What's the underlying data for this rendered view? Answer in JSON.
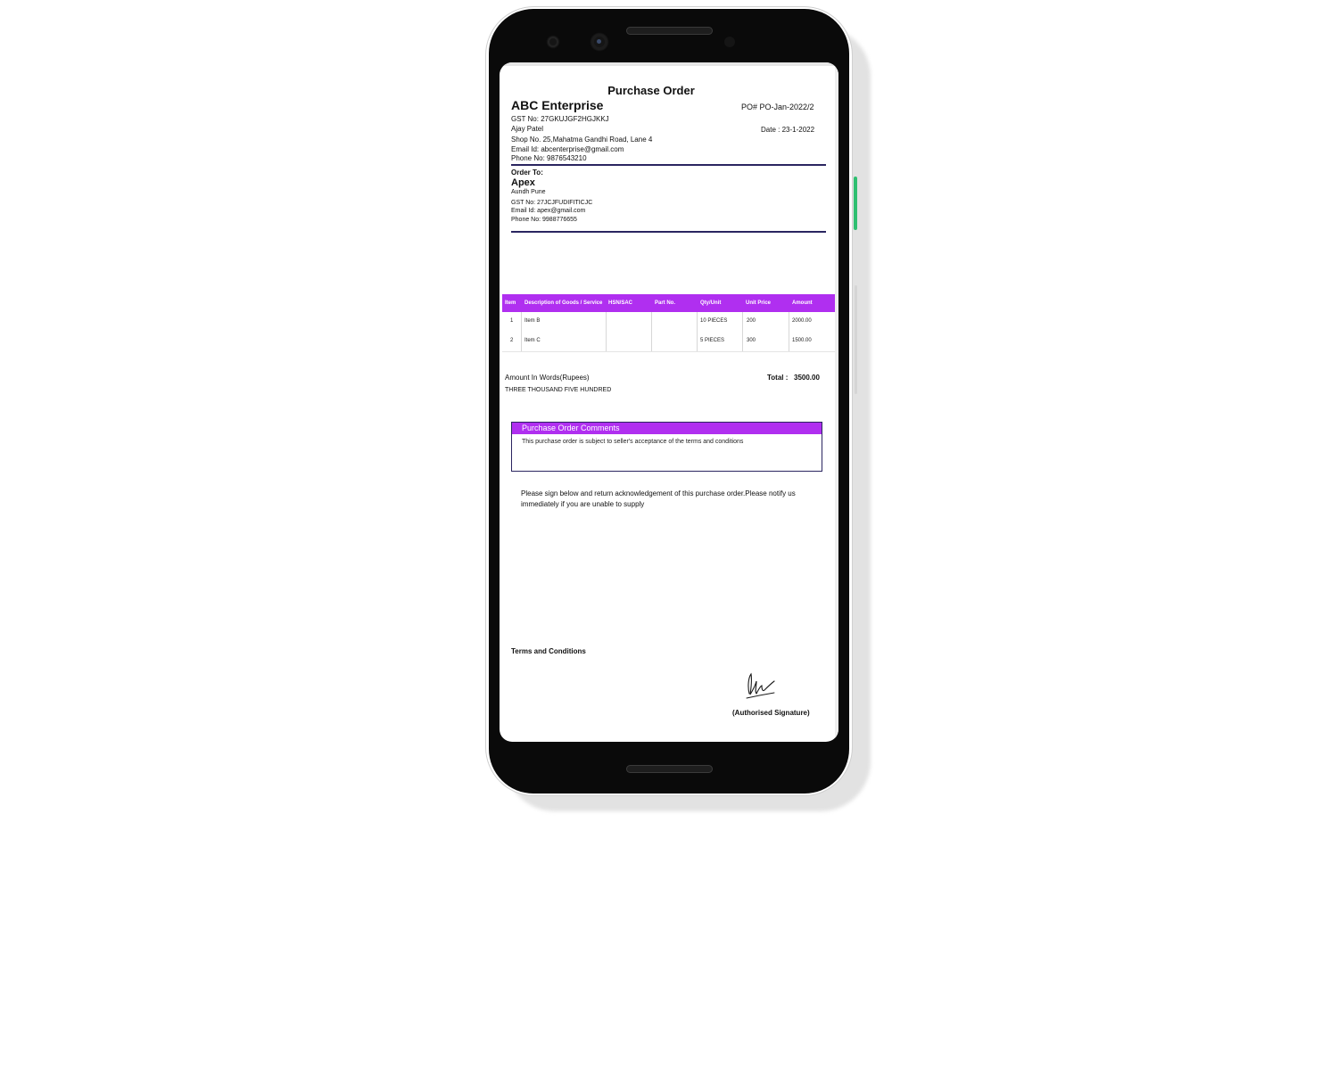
{
  "document": {
    "title": "Purchase Order",
    "company": {
      "name": "ABC Enterprise",
      "gst": "GST No: 27GKUJGF2HGJKKJ",
      "contact": "Ajay Patel",
      "address": "Shop No. 25,Mahatma Gandhi Road, Lane 4",
      "email": "Email Id: abcenterprise@gmail.com",
      "phone": "Phone No: 9876543210"
    },
    "po_number": "PO# PO-Jan-2022/2",
    "date": "Date : 23-1-2022",
    "order_to": {
      "label": "Order To:",
      "name": "Apex",
      "address": "Aundh Pune",
      "gst": "GST No: 27JCJFUDIFITICJC",
      "email": "Email Id: apex@gmail.com",
      "phone": "Phone No: 9988776655"
    },
    "table": {
      "headers": [
        "Item",
        "Description of Goods / Service",
        "HSN/SAC",
        "Part No.",
        "Qty/Unit",
        "Unit Price",
        "Amount"
      ],
      "rows": [
        [
          "1",
          "Item B",
          "",
          "",
          "10 PIECES",
          "200",
          "2000.00"
        ],
        [
          "2",
          "Item C",
          "",
          "",
          "5 PIECES",
          "300",
          "1500.00"
        ]
      ]
    },
    "amount_in_words_label": "Amount In Words(Rupees)",
    "amount_in_words": "THREE THOUSAND FIVE HUNDRED",
    "total_label": "Total :",
    "total_value": "3500.00",
    "comments": {
      "title": "Purchase Order Comments",
      "text": "This purchase order is subject to seller's acceptance of the terms and conditions"
    },
    "note": "Please sign below and return acknowledgement of this purchase order.Please notify us immediately if you are unable to supply",
    "terms_label": "Terms and Conditions",
    "signature_label": "(Authorised Signature)"
  },
  "colors": {
    "accent": "#b02ff0",
    "rule": "#2a2560",
    "phone_frame": "#0a0a0a",
    "side_button": "#2fbf71"
  }
}
